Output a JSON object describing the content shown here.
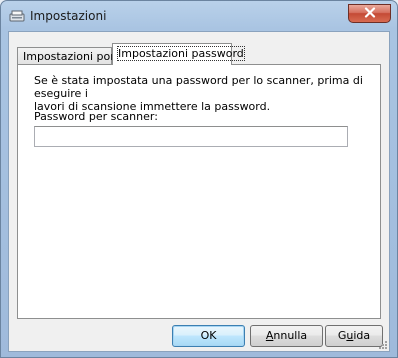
{
  "window": {
    "title": "Impostazioni"
  },
  "tabs": [
    {
      "label": "Impostazioni porta",
      "active": false
    },
    {
      "label": "Impostazioni password",
      "active": true
    }
  ],
  "panel": {
    "description_line1": "Se è stata impostata una password per lo scanner, prima di eseguire i",
    "description_line2": "lavori di scansione immettere la password.",
    "password_label": "Password per scanner:",
    "password_value": ""
  },
  "buttons": {
    "ok": {
      "label": "OK"
    },
    "cancel": {
      "prefix": "",
      "mnemonic": "A",
      "rest": "nnulla"
    },
    "help": {
      "prefix": "G",
      "mnemonic": "u",
      "rest": "ida"
    }
  },
  "icons": {
    "app": "scanner-settings-icon",
    "close": "close-icon",
    "grip": "resize-grip-icon"
  }
}
